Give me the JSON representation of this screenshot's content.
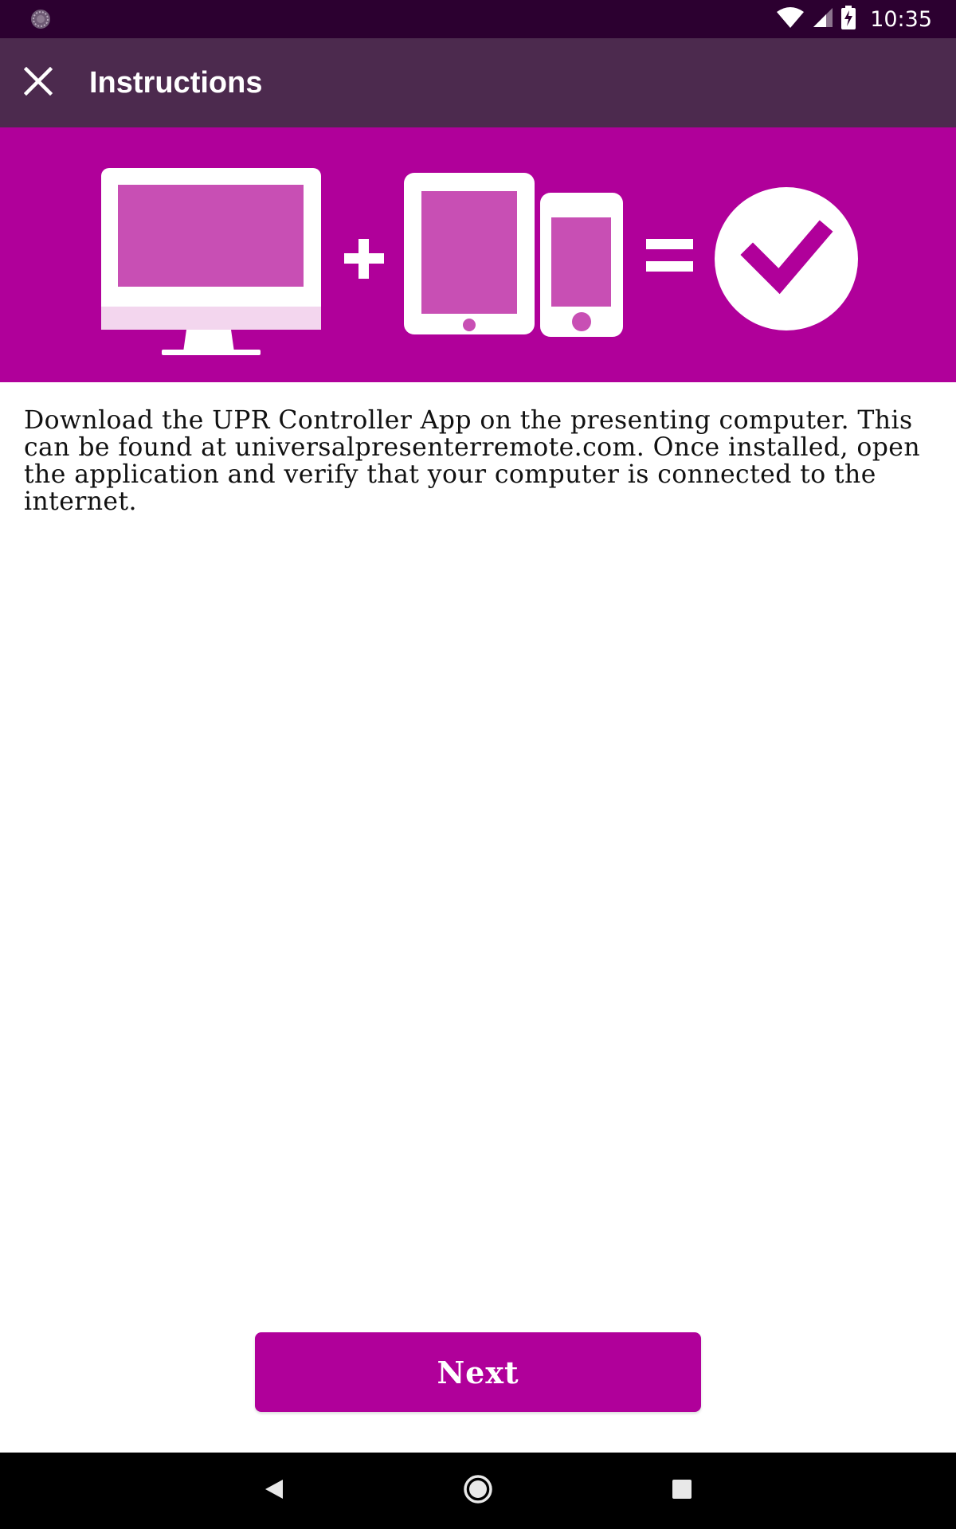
{
  "status_bar": {
    "time": "10:35",
    "icons": [
      "loading-icon",
      "wifi-icon",
      "signal-icon",
      "battery-charging-icon"
    ]
  },
  "app_bar": {
    "title": "Instructions",
    "close_icon": "close-icon"
  },
  "banner": {
    "background_color": "#b0009a",
    "icons": [
      "monitor-icon",
      "plus-icon",
      "tablet-icon",
      "phone-icon",
      "equals-icon",
      "check-circle-icon"
    ]
  },
  "content": {
    "instruction_text": "Download the UPR Controller App on the presenting computer. This can be found at universalpresenterremote.com. Once installed, open the application and verify that your computer is connected to the internet."
  },
  "actions": {
    "next_label": "Next"
  },
  "colors": {
    "status_bar": "#2c0030",
    "app_bar": "#4c2a4e",
    "accent": "#b0009a",
    "nav_bar": "#000000"
  },
  "nav_bar": {
    "icons": [
      "back-icon",
      "home-icon",
      "recents-icon"
    ]
  }
}
